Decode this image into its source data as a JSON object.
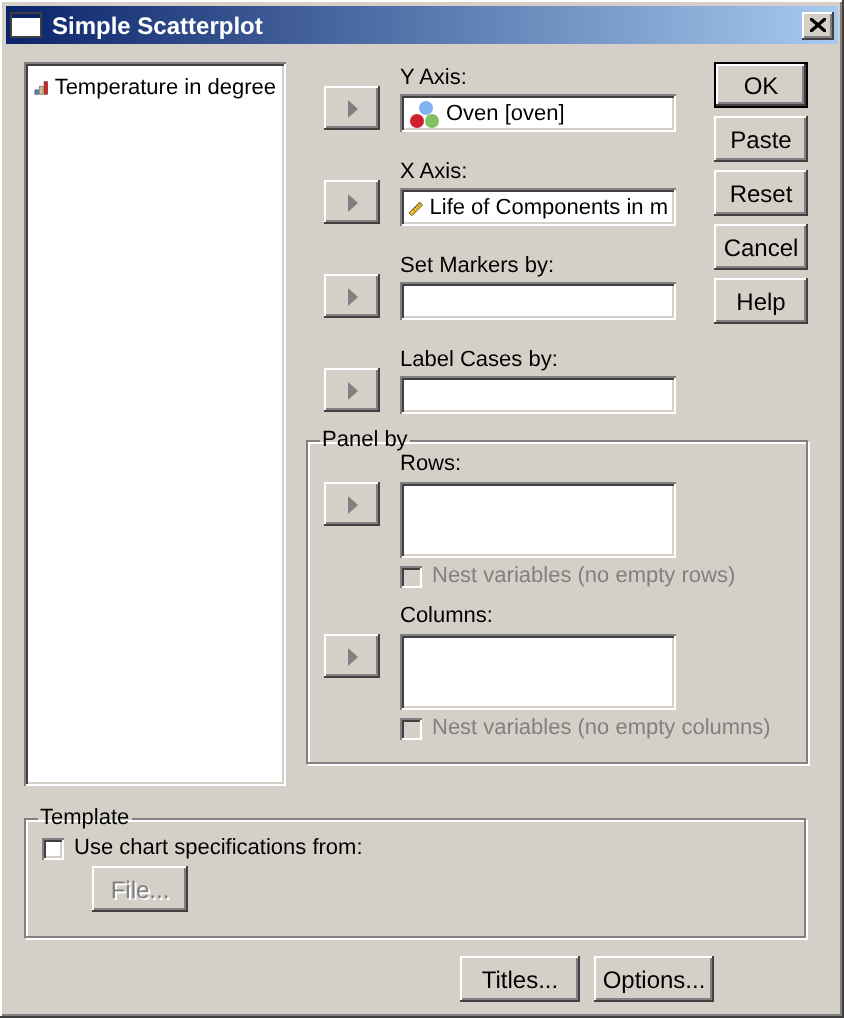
{
  "window": {
    "title": "Simple Scatterplot"
  },
  "variables": [
    {
      "label": "Temperature in degree",
      "kind": "ordinal",
      "selected": false
    }
  ],
  "targets": [
    {
      "label": "Y Axis:",
      "value": "Oven [oven]",
      "kind": "nominal"
    },
    {
      "label": "X Axis:",
      "value": "Life of Components in m",
      "kind": "scale"
    },
    {
      "label": "Set Markers by:"
    },
    {
      "label": "Label Cases by:"
    }
  ],
  "action_buttons": [
    {
      "label": "OK",
      "default": true
    },
    {
      "label": "Paste",
      "default": false
    },
    {
      "label": "Reset",
      "default": false
    },
    {
      "label": "Cancel",
      "default": false
    },
    {
      "label": "Help",
      "default": false
    }
  ],
  "panel_by": {
    "title": "Panel by",
    "sections": [
      {
        "label": "Rows:",
        "nest": {
          "label": "Nest variables (no empty rows)",
          "checked": false,
          "disabled": true
        }
      },
      {
        "label": "Columns:",
        "nest": {
          "label": "Nest variables (no empty columns)",
          "checked": false,
          "disabled": true
        }
      }
    ]
  },
  "template": {
    "title": "Template",
    "use": {
      "label": "Use chart specifications from:",
      "checked": false
    },
    "file_button": {
      "label": "File...",
      "disabled": true
    }
  },
  "bottom_buttons": [
    {
      "label": "Titles..."
    },
    {
      "label": "Options..."
    }
  ]
}
